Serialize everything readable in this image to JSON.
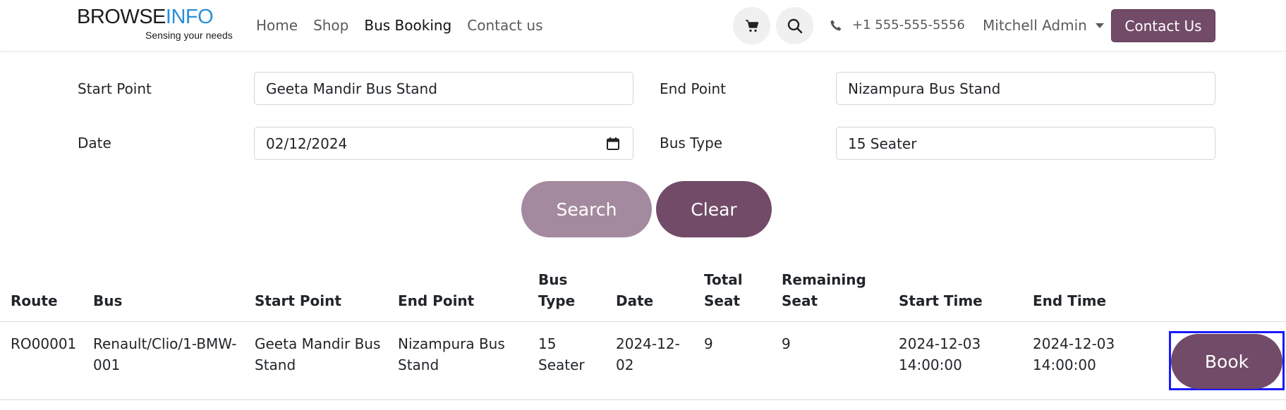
{
  "header": {
    "logo_main_1": "BROWSE",
    "logo_main_2": "INFO",
    "logo_tagline": "Sensing your needs",
    "nav": [
      {
        "label": "Home"
      },
      {
        "label": "Shop"
      },
      {
        "label": "Bus Booking"
      },
      {
        "label": "Contact us"
      }
    ],
    "cart_icon": "cart-icon",
    "search_icon": "search-icon",
    "phone_icon": "phone-icon",
    "phone": "+1 555-555-5556",
    "user": "Mitchell Admin",
    "contact_button": "Contact Us"
  },
  "form": {
    "start_point_label": "Start Point",
    "start_point_value": "Geeta Mandir Bus Stand",
    "end_point_label": "End Point",
    "end_point_value": "Nizampura Bus Stand",
    "date_label": "Date",
    "date_value": "02/12/2024",
    "bus_type_label": "Bus Type",
    "bus_type_value": "15 Seater",
    "search_button": "Search",
    "clear_button": "Clear"
  },
  "table": {
    "headers": {
      "route": "Route",
      "bus": "Bus",
      "start_point": "Start Point",
      "end_point": "End Point",
      "bus_type_1": "Bus",
      "bus_type_2": "Type",
      "date": "Date",
      "total_seat_1": "Total",
      "total_seat_2": "Seat",
      "remaining_seat_1": "Remaining",
      "remaining_seat_2": "Seat",
      "start_time": "Start Time",
      "end_time": "End Time"
    },
    "rows": [
      {
        "route": "RO00001",
        "bus_1": "Renault/Clio/1-BMW-",
        "bus_2": "001",
        "start_point_1": "Geeta Mandir Bus",
        "start_point_2": "Stand",
        "end_point_1": "Nizampura Bus",
        "end_point_2": "Stand",
        "bus_type_1": "15",
        "bus_type_2": "Seater",
        "date_1": "2024-12-",
        "date_2": "02",
        "total_seat": "9",
        "remaining_seat": "9",
        "start_time_1": "2024-12-03",
        "start_time_2": "14:00:00",
        "end_time_1": "2024-12-03",
        "end_time_2": "14:00:00",
        "book_button": "Book"
      }
    ]
  },
  "colors": {
    "brand": "#714b67",
    "brand_light": "#a48a9e",
    "logo_blue": "#2a8fd9",
    "highlight": "#1a1aff"
  }
}
